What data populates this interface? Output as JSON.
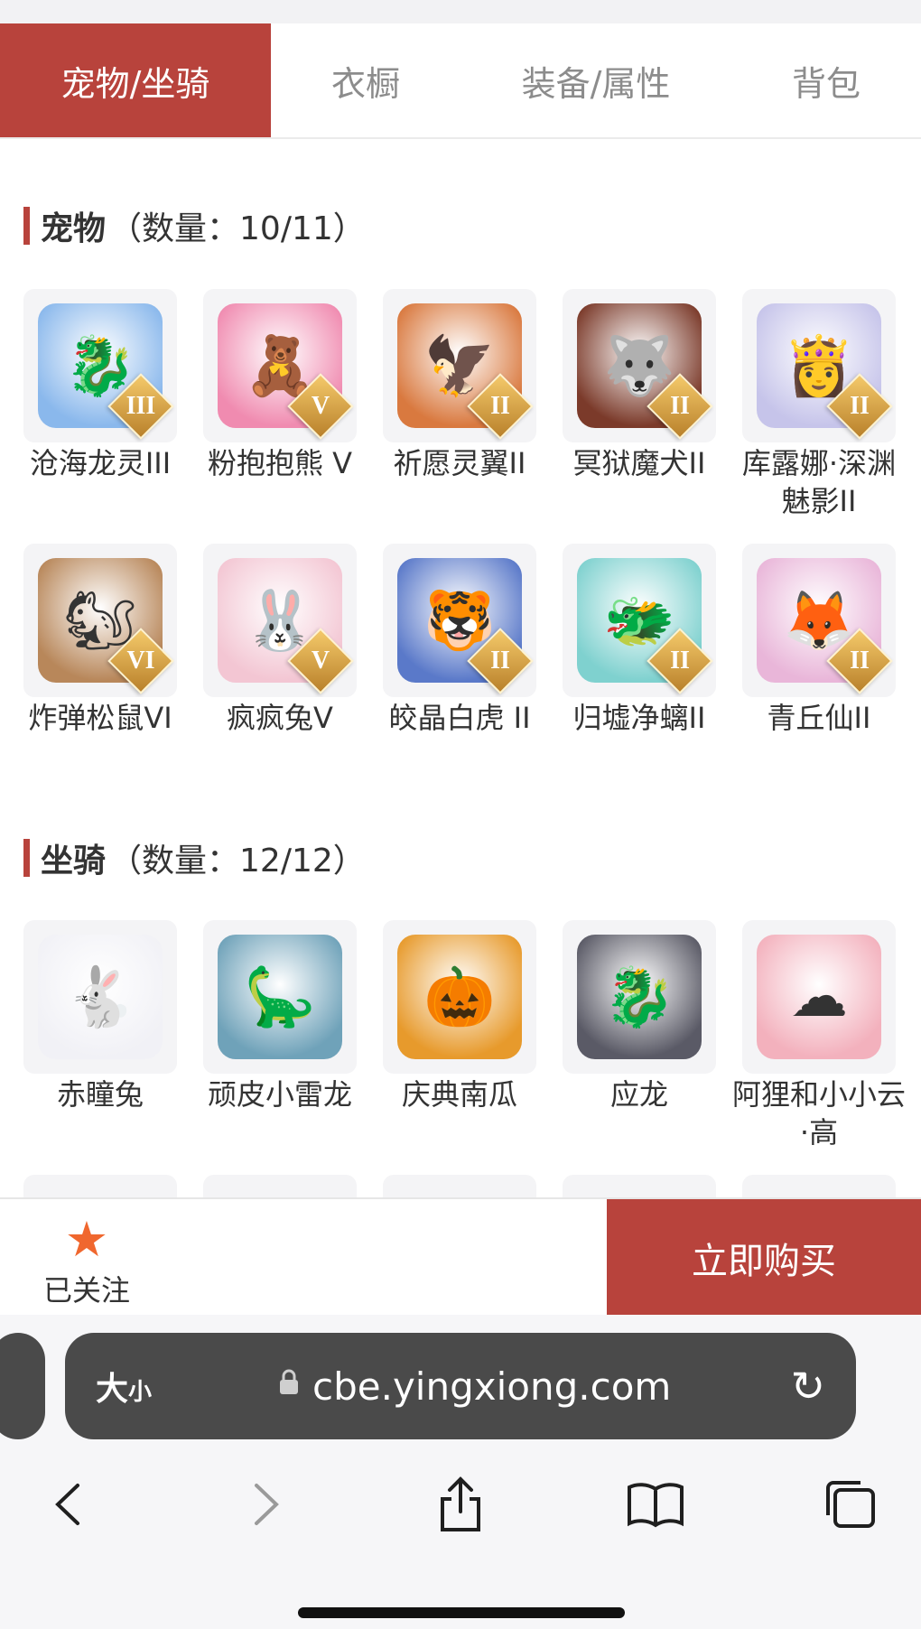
{
  "tabs": [
    {
      "label": "宠物/坐骑",
      "active": true
    },
    {
      "label": "衣橱",
      "active": false
    },
    {
      "label": "装备/属性",
      "active": false
    },
    {
      "label": "背包",
      "active": false
    }
  ],
  "pets": {
    "title": "宠物",
    "count": "（数量：10/11）",
    "items": [
      {
        "name": "沧海龙灵III",
        "badge": "III",
        "color": "#8ab8ec",
        "icon": "dragon-spirit"
      },
      {
        "name": "粉抱抱熊 V",
        "badge": "V",
        "color": "#f08bb0",
        "icon": "bear"
      },
      {
        "name": "祈愿灵翼II",
        "badge": "II",
        "color": "#d9793f",
        "icon": "phoenix"
      },
      {
        "name": "冥狱魔犬II",
        "badge": "II",
        "color": "#7b3a2a",
        "icon": "hellhound"
      },
      {
        "name": "库露娜·深渊魅影II",
        "badge": "II",
        "color": "#c6c4ea",
        "icon": "girl"
      },
      {
        "name": "炸弹松鼠VI",
        "badge": "VI",
        "color": "#b8875a",
        "icon": "squirrel"
      },
      {
        "name": "疯疯兔V",
        "badge": "V",
        "color": "#f3c6d3",
        "icon": "rabbit"
      },
      {
        "name": "皎晶白虎 II",
        "badge": "II",
        "color": "#5a79c9",
        "icon": "tiger"
      },
      {
        "name": "归墟净螭II",
        "badge": "II",
        "color": "#7fd1cf",
        "icon": "sea-dragon"
      },
      {
        "name": "青丘仙II",
        "badge": "II",
        "color": "#e9b6d9",
        "icon": "fox-girl"
      }
    ]
  },
  "mounts": {
    "title": "坐骑",
    "count": "（数量：12/12）",
    "items": [
      {
        "name": "赤瞳兔",
        "color": "#f1f1f6",
        "icon": "white-rabbit"
      },
      {
        "name": "顽皮小雷龙",
        "color": "#6fa2b9",
        "icon": "dino"
      },
      {
        "name": "庆典南瓜",
        "color": "#e79a2c",
        "icon": "pumpkin"
      },
      {
        "name": "应龙",
        "color": "#5a5a66",
        "icon": "dragon"
      },
      {
        "name": "阿狸和小小云·高",
        "color": "#f3b1bd",
        "icon": "fox-cloud"
      }
    ]
  },
  "bottom": {
    "follow_label": "已关注",
    "buy_label": "立即购买"
  },
  "browser": {
    "text_size": "大",
    "text_size_small": "小",
    "url": "cbe.yingxiong.com"
  }
}
